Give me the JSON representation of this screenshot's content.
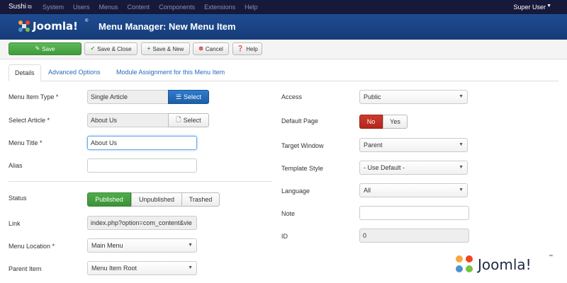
{
  "topnav": {
    "site": "Sushi",
    "site_ext_icon": "external-link-icon",
    "menu": [
      "System",
      "Users",
      "Menus",
      "Content",
      "Components",
      "Extensions",
      "Help"
    ],
    "user": "Super User"
  },
  "header": {
    "logo_text": "Joomla!",
    "trademark": "®",
    "title": "Menu Manager: New Menu Item"
  },
  "toolbar": {
    "save": "Save",
    "save_close": "Save & Close",
    "save_new": "Save & New",
    "cancel": "Cancel",
    "help": "Help"
  },
  "tabs": [
    "Details",
    "Advanced Options",
    "Module Assignment for this Menu Item"
  ],
  "left": {
    "menu_item_type": {
      "label": "Menu Item Type *",
      "value": "Single Article",
      "button": "Select"
    },
    "select_article": {
      "label": "Select Article *",
      "value": "About Us",
      "button": "Select"
    },
    "menu_title": {
      "label": "Menu Title *",
      "value": "About Us"
    },
    "alias": {
      "label": "Alias",
      "value": ""
    },
    "status": {
      "label": "Status",
      "options": [
        "Published",
        "Unpublished",
        "Trashed"
      ],
      "selected": "Published"
    },
    "link": {
      "label": "Link",
      "value": "index.php?option=com_content&vie"
    },
    "menu_location": {
      "label": "Menu Location *",
      "value": "Main Menu"
    },
    "parent_item": {
      "label": "Parent Item",
      "value": "Menu Item Root"
    }
  },
  "right": {
    "access": {
      "label": "Access",
      "value": "Public"
    },
    "default_page": {
      "label": "Default Page",
      "options": [
        "No",
        "Yes"
      ],
      "selected": "No"
    },
    "target_window": {
      "label": "Target Window",
      "value": "Parent"
    },
    "template_style": {
      "label": "Template Style",
      "value": "- Use Default -"
    },
    "language": {
      "label": "Language",
      "value": "All"
    },
    "note": {
      "label": "Note",
      "value": ""
    },
    "id": {
      "label": "ID",
      "value": "0"
    }
  },
  "watermark": {
    "text": "Joomla!",
    "trademark": "™"
  },
  "colors": {
    "topnav": "#17193a",
    "header": "#1f4c92",
    "save_green": "#46a340",
    "select_blue": "#2468b8",
    "no_red": "#c0302a",
    "tab_link": "#2a69b8"
  }
}
